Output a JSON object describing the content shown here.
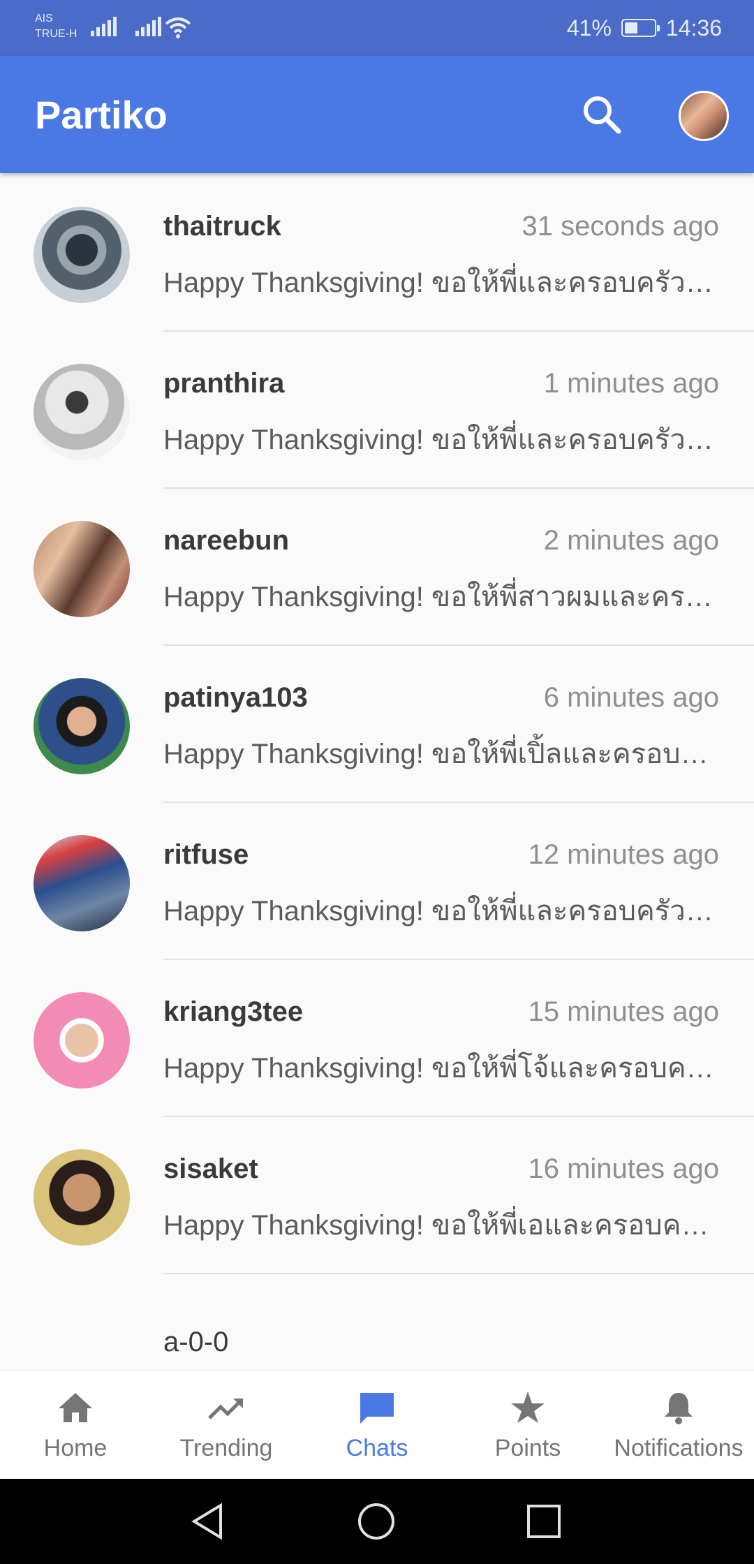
{
  "status_bar": {
    "carrier_top": "AIS",
    "carrier_bottom": "TRUE-H",
    "battery": "41%",
    "time": "14:36"
  },
  "app_bar": {
    "title": "Partiko",
    "search_icon": "search-icon",
    "avatar_icon": "profile-avatar"
  },
  "chats": [
    {
      "name": "thaitruck",
      "time": "31 seconds ago",
      "message": "Happy Thanksgiving! ขอให้พี่และครอบครัวมีความสุขมากๆ นะครับ"
    },
    {
      "name": "pranthira",
      "time": "1 minutes ago",
      "message": "Happy Thanksgiving! ขอให้พี่และครอบครัวมีความสุขมากๆ นะครับ"
    },
    {
      "name": "nareebun",
      "time": "2 minutes ago",
      "message": "Happy Thanksgiving! ขอให้พี่สาวผมและครอบครัวมีความสุขมากๆ นะครับ"
    },
    {
      "name": "patinya103",
      "time": "6 minutes ago",
      "message": "Happy Thanksgiving! ขอให้พี่เปิ้ลและครอบครัวมีความสุขมากๆ นะครับ"
    },
    {
      "name": "ritfuse",
      "time": "12 minutes ago",
      "message": "Happy Thanksgiving! ขอให้พี่และครอบครัวมีความสุขมากๆ นะครับ"
    },
    {
      "name": "kriang3tee",
      "time": "15 minutes ago",
      "message": "Happy Thanksgiving! ขอให้พี่โจ้และครอบครัวมีความสุขมากๆ นะครับ"
    },
    {
      "name": "sisaket",
      "time": "16 minutes ago",
      "message": "Happy Thanksgiving! ขอให้พี่เอและครอบครัวมีความสุขมากๆ นะครับ"
    }
  ],
  "list_footer": "a-0-0",
  "bottom_nav": [
    {
      "label": "Home",
      "icon": "home-icon"
    },
    {
      "label": "Trending",
      "icon": "trending-icon"
    },
    {
      "label": "Chats",
      "icon": "chat-icon",
      "active": true
    },
    {
      "label": "Points",
      "icon": "star-icon"
    },
    {
      "label": "Notifications",
      "icon": "bell-icon"
    }
  ],
  "colors": {
    "status_bar": "#4a6bc8",
    "app_bar": "#4b79e4",
    "accent": "#4b79e4",
    "background": "#fafafa"
  }
}
